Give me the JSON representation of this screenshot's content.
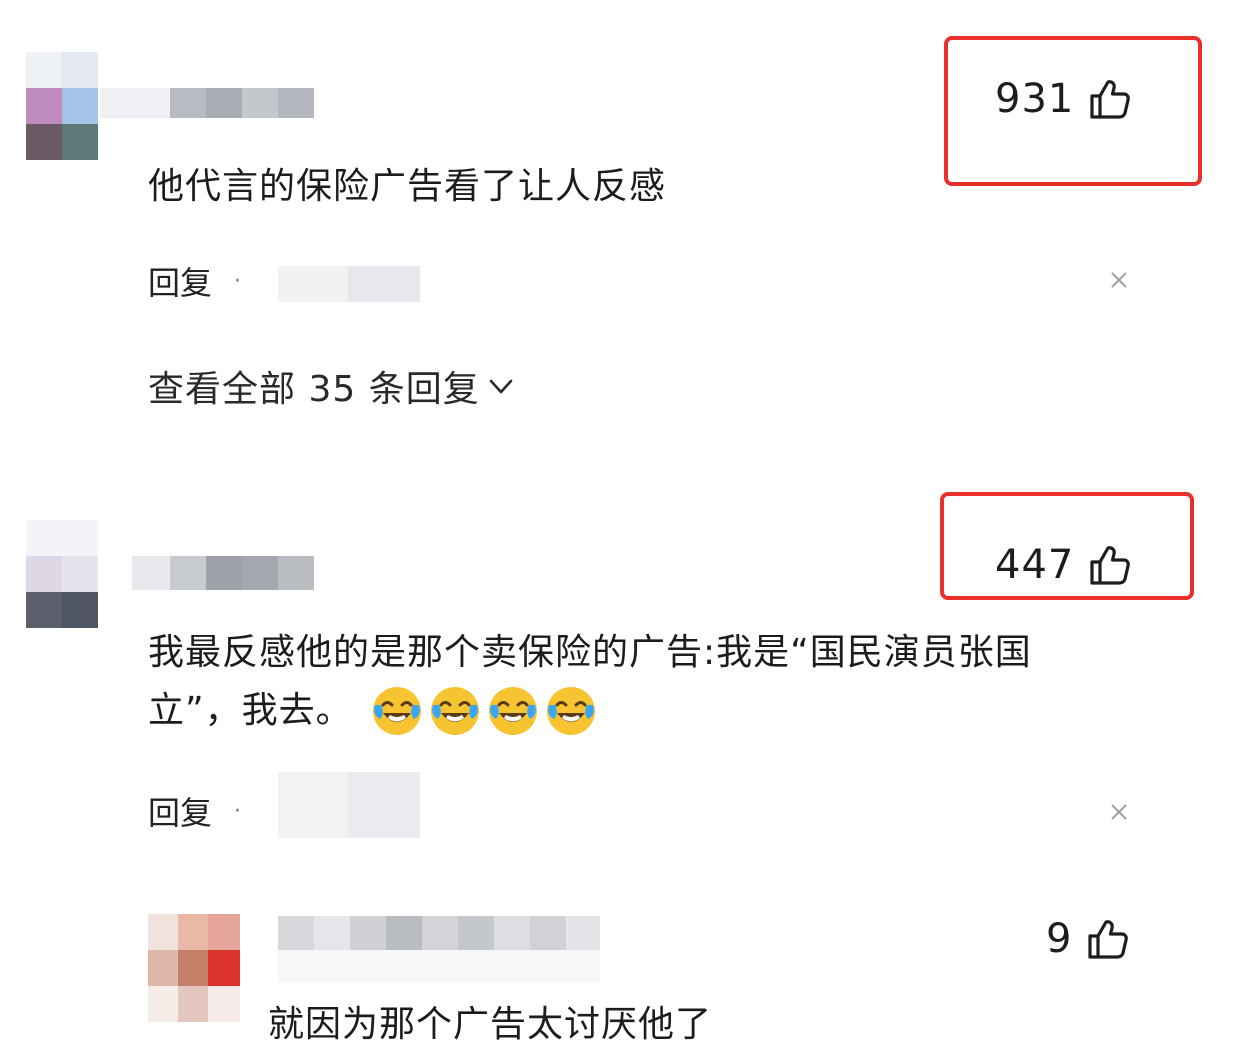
{
  "comments": [
    {
      "text": "他代言的保险广告看了让人反感",
      "likes": "931",
      "reply_label": "回复",
      "dot": "·",
      "view_all": "查看全部 35 条回复"
    },
    {
      "text_line1": "我最反感他的是那个卖保险的广告:我是“国民演员张国",
      "text_line2": "立”，我去。",
      "likes": "447",
      "reply_label": "回复",
      "dot": "·",
      "emoji_count": 4
    },
    {
      "text": "就因为那个广告太讨厌他了",
      "likes": "9"
    }
  ],
  "colors": {
    "highlight": "#e8302a",
    "emoji_face": "#f7c431",
    "emoji_tear": "#3aa5f2"
  },
  "icons": {
    "like": "thumbs-up-icon",
    "close": "close-icon",
    "expand": "chevron-down-icon",
    "emoji": "crying-laughing-emoji"
  }
}
